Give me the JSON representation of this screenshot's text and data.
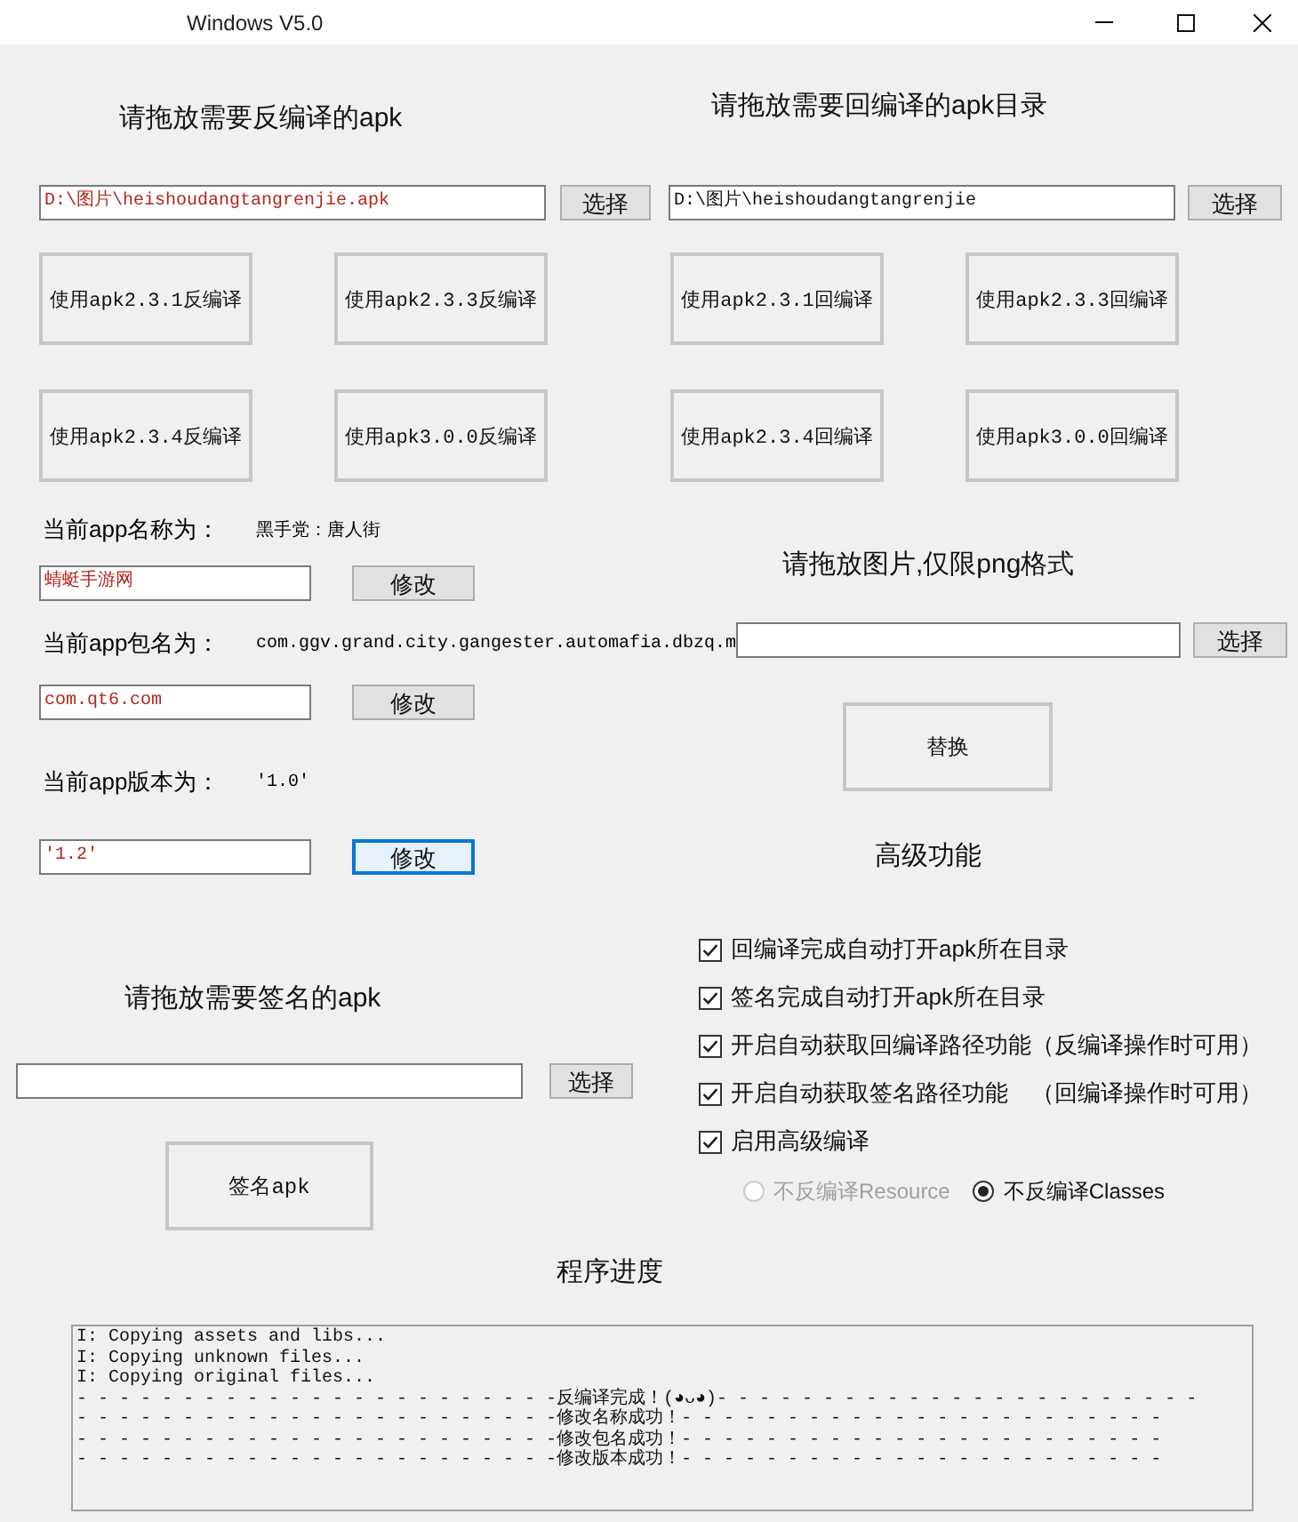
{
  "window": {
    "title": "Windows V5.0"
  },
  "decompile": {
    "heading": "请拖放需要反编译的apk",
    "path": "D:\\图片\\heishoudangtangrenjie.apk",
    "browse_button": "选择",
    "buttons": [
      "使用apk2.3.1反编译",
      "使用apk2.3.3反编译",
      "使用apk2.3.4反编译",
      "使用apk3.0.0反编译"
    ]
  },
  "recompile": {
    "heading": "请拖放需要回编译的apk目录",
    "path": "D:\\图片\\heishoudangtangrenjie",
    "browse_button": "选择",
    "buttons": [
      "使用apk2.3.1回编译",
      "使用apk2.3.3回编译",
      "使用apk2.3.4回编译",
      "使用apk3.0.0回编译"
    ]
  },
  "app_info": [
    {
      "label": "当前app名称为：",
      "current": "黑手党：唐人街",
      "value": "蜻蜓手游网",
      "button": "修改",
      "focused": false
    },
    {
      "label": "当前app包名为：",
      "current": "com.ggv.grand.city.gangester.automafia.dbzq.m",
      "value": "com.qt6.com",
      "button": "修改",
      "focused": false
    },
    {
      "label": "当前app版本为：",
      "current": "'1.0'",
      "value": "'1.2'",
      "button": "修改",
      "focused": true
    }
  ],
  "icon_replace": {
    "heading": "请拖放图片,仅限png格式",
    "browse_button": "选择",
    "replace_button": "替换"
  },
  "advanced": {
    "heading": "高级功能",
    "options": [
      {
        "label": "回编译完成自动打开apk所在目录",
        "checked": true
      },
      {
        "label": "签名完成自动打开apk所在目录",
        "checked": true
      },
      {
        "label": "开启自动获取回编译路径功能（反编译操作时可用）",
        "checked": true
      },
      {
        "label": "开启自动获取签名路径功能　（回编译操作时可用）",
        "checked": true
      },
      {
        "label": "启用高级编译",
        "checked": true
      }
    ],
    "modes": [
      {
        "label": "不反编译Resource",
        "selected": false,
        "disabled": true
      },
      {
        "label": "不反编译Classes",
        "selected": true,
        "disabled": false
      }
    ]
  },
  "sign": {
    "heading": "请拖放需要签名的apk",
    "browse_button": "选择",
    "sign_button": "签名apk"
  },
  "progress": {
    "heading": "程序进度",
    "log": [
      "I: Copying assets and libs...",
      "I: Copying unknown files...",
      "I: Copying original files...",
      "- - - - - - - - - - - - - - - - - - - - - - -反编译完成！(◕ᴗ◕)- - - - - - - - - - - - - - - - - - - - - - -",
      "- - - - - - - - - - - - - - - - - - - - - - -修改名称成功！- - - - - - - - - - - - - - - - - - - - - - -",
      "- - - - - - - - - - - - - - - - - - - - - - -修改包名成功！- - - - - - - - - - - - - - - - - - - - - - -",
      "- - - - - - - - - - - - - - - - - - - - - - -修改版本成功！- - - - - - - - - - - - - - - - - - - - - - -"
    ]
  }
}
